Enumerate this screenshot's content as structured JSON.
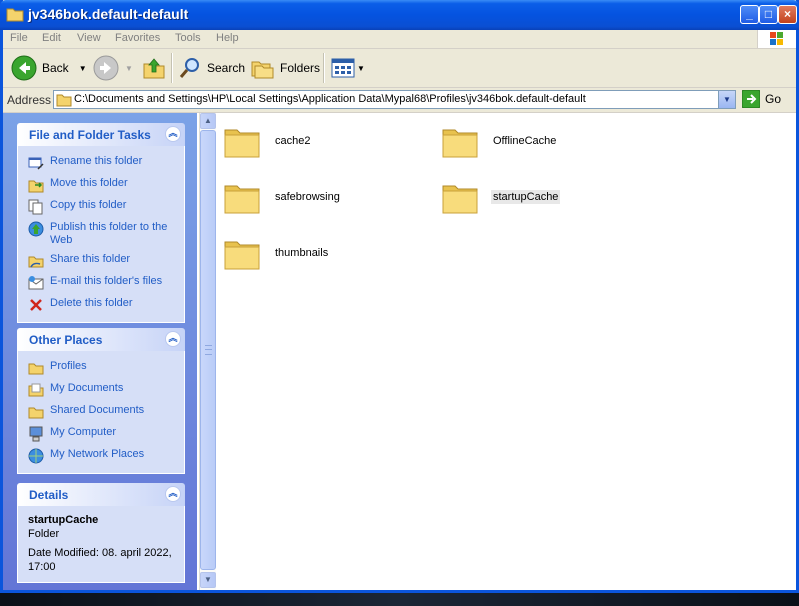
{
  "window": {
    "title": "jv346bok.default-default",
    "minimize": "_",
    "maximize": "□",
    "close": "×"
  },
  "menu": [
    "File",
    "Edit",
    "View",
    "Favorites",
    "Tools",
    "Help"
  ],
  "toolbar": {
    "back": "Back",
    "search": "Search",
    "folders": "Folders"
  },
  "address": {
    "label": "Address",
    "path": "C:\\Documents and Settings\\HP\\Local Settings\\Application Data\\Mypal68\\Profiles\\jv346bok.default-default",
    "go": "Go"
  },
  "tasks_panel": {
    "title": "File and Folder Tasks",
    "items": [
      {
        "label": "Rename this folder",
        "icon": "rename-icon"
      },
      {
        "label": "Move this folder",
        "icon": "move-icon"
      },
      {
        "label": "Copy this folder",
        "icon": "copy-icon"
      },
      {
        "label": "Publish this folder to the Web",
        "icon": "publish-web-icon"
      },
      {
        "label": "Share this folder",
        "icon": "share-icon"
      },
      {
        "label": "E-mail this folder's files",
        "icon": "email-icon"
      },
      {
        "label": "Delete this folder",
        "icon": "delete-icon"
      }
    ]
  },
  "places_panel": {
    "title": "Other Places",
    "items": [
      {
        "label": "Profiles",
        "icon": "folder-icon"
      },
      {
        "label": "My Documents",
        "icon": "my-documents-icon"
      },
      {
        "label": "Shared Documents",
        "icon": "shared-documents-icon"
      },
      {
        "label": "My Computer",
        "icon": "my-computer-icon"
      },
      {
        "label": "My Network Places",
        "icon": "network-places-icon"
      }
    ]
  },
  "details_panel": {
    "title": "Details",
    "name": "startupCache",
    "type": "Folder",
    "modified": "Date Modified: 08. april 2022, 17:00"
  },
  "files": [
    {
      "name": "cache2",
      "selected": false
    },
    {
      "name": "OfflineCache",
      "selected": false
    },
    {
      "name": "safebrowsing",
      "selected": false
    },
    {
      "name": "startupCache",
      "selected": true
    },
    {
      "name": "thumbnails",
      "selected": false
    }
  ],
  "colors": {
    "titlebar": "#0553e0",
    "taskpane": "#6f8de0",
    "link": "#215dc6",
    "folder": "#f4d36c"
  }
}
